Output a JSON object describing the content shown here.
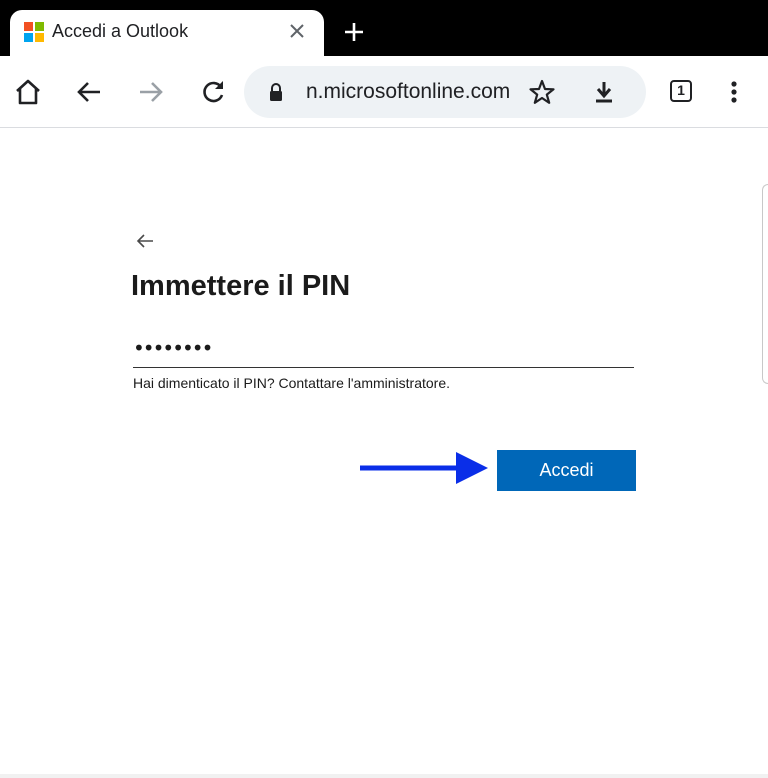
{
  "browser": {
    "tab": {
      "title": "Accedi a Outlook",
      "favicon": "microsoft-logo",
      "favicon_colors": [
        "#f25022",
        "#7fba00",
        "#00a4ef",
        "#ffb900"
      ]
    },
    "tab_count": "1",
    "address_bar": {
      "url": "n.microsoftonline.com",
      "secure": true
    },
    "icons": [
      "home-icon",
      "back-icon",
      "forward-icon",
      "reload-icon",
      "lock-icon",
      "star-icon",
      "download-icon",
      "tab-switcher-icon",
      "more-menu-icon",
      "close-icon",
      "plus-icon"
    ]
  },
  "page": {
    "heading": "Immettere il PIN",
    "pin_field": {
      "value": "••••••••",
      "masked": true
    },
    "forgot_text": "Hai dimenticato il PIN? Contattare l'amministratore.",
    "submit_label": "Accedi",
    "accent_color": "#0067b8",
    "annotation_arrow_color": "#0a2ee8"
  }
}
